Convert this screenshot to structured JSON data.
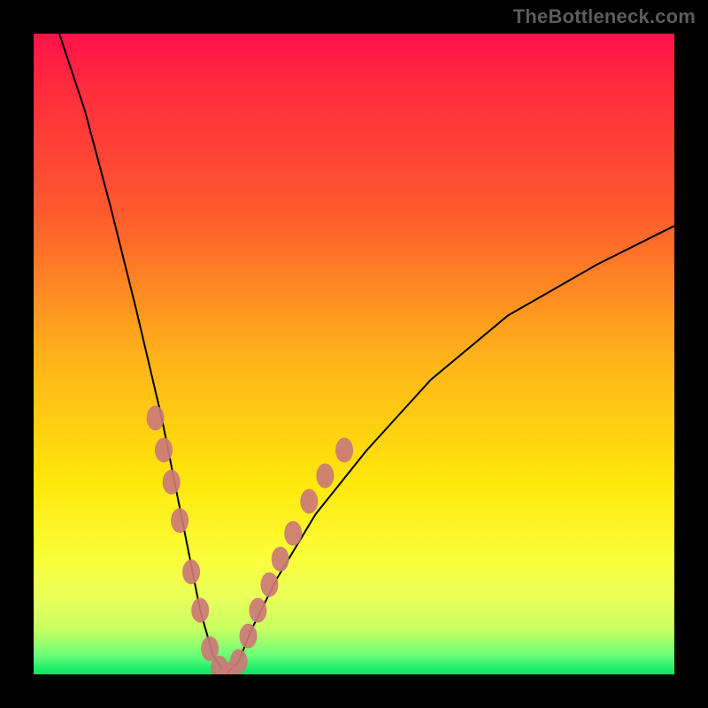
{
  "watermark": "TheBottleneck.com",
  "colors": {
    "frame": "#000000",
    "gradient_top": "#ff124a",
    "gradient_bottom": "#00e765",
    "curve": "#000000",
    "dots": "#cb7a77"
  },
  "chart_data": {
    "type": "line",
    "title": "",
    "xlabel": "",
    "ylabel": "",
    "xlim": [
      0,
      100
    ],
    "ylim": [
      0,
      100
    ],
    "annotations": [
      "TheBottleneck.com"
    ],
    "series": [
      {
        "name": "bottleneck-curve",
        "x": [
          4,
          8,
          12,
          16,
          20,
          22,
          24,
          26,
          28,
          30,
          32,
          34,
          38,
          44,
          52,
          62,
          74,
          88,
          100
        ],
        "y": [
          100,
          88,
          73,
          57,
          40,
          30,
          20,
          10,
          3,
          0,
          2,
          7,
          15,
          25,
          35,
          46,
          56,
          64,
          70
        ]
      }
    ],
    "markers": [
      {
        "x": 19.0,
        "y": 40
      },
      {
        "x": 20.3,
        "y": 35
      },
      {
        "x": 21.5,
        "y": 30
      },
      {
        "x": 22.8,
        "y": 24
      },
      {
        "x": 24.6,
        "y": 16
      },
      {
        "x": 26.0,
        "y": 10
      },
      {
        "x": 27.5,
        "y": 4
      },
      {
        "x": 29.0,
        "y": 1
      },
      {
        "x": 30.5,
        "y": 0
      },
      {
        "x": 32.0,
        "y": 2
      },
      {
        "x": 33.5,
        "y": 6
      },
      {
        "x": 35.0,
        "y": 10
      },
      {
        "x": 36.8,
        "y": 14
      },
      {
        "x": 38.5,
        "y": 18
      },
      {
        "x": 40.5,
        "y": 22
      },
      {
        "x": 43.0,
        "y": 27
      },
      {
        "x": 45.5,
        "y": 31
      },
      {
        "x": 48.5,
        "y": 35
      }
    ]
  }
}
